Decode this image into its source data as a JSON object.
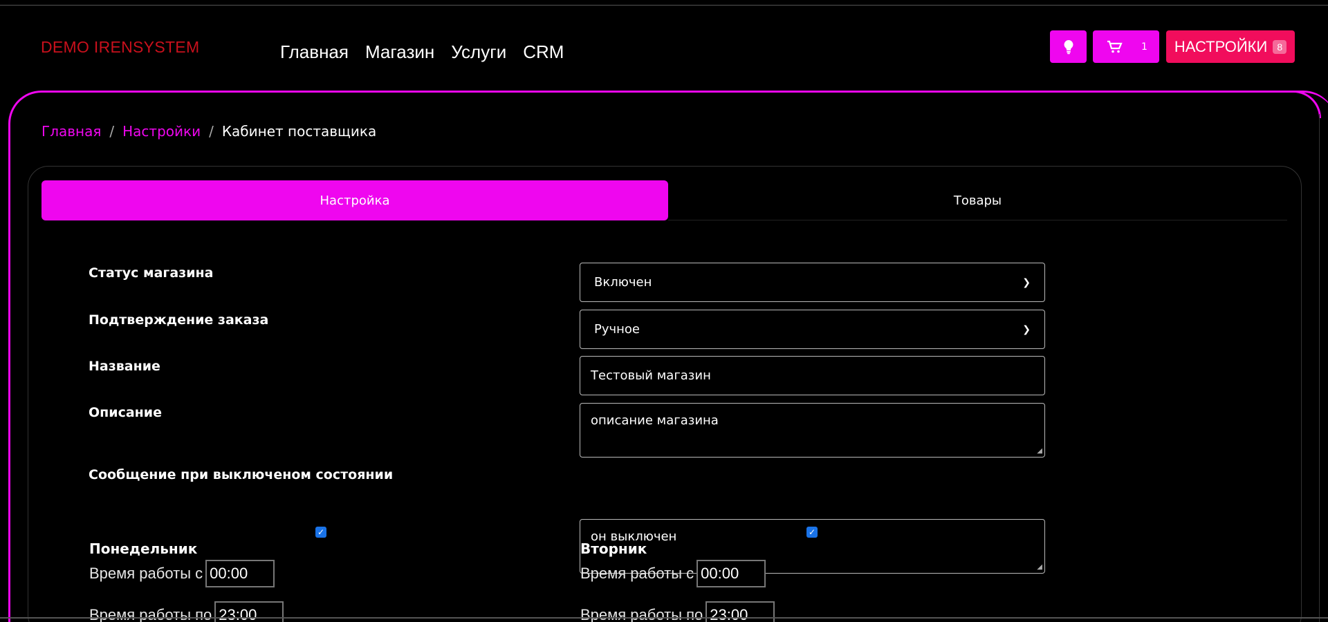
{
  "brand": "DEMO IRENSYSTEM",
  "nav": [
    "Главная",
    "Магазин",
    "Услуги",
    "CRM"
  ],
  "header_buttons": {
    "cart_count": "1",
    "settings_label": "НАСТРОЙКИ",
    "settings_badge": "8"
  },
  "breadcrumb": {
    "home": "Главная",
    "settings": "Настройки",
    "current": "Кабинет поставщика",
    "sep": "/"
  },
  "tabs": {
    "settings": "Настройка",
    "goods": "Товары"
  },
  "form": {
    "status_label": "Статус магазина",
    "status_value": "Включен",
    "confirm_label": "Подтверждение заказа",
    "confirm_value": "Ручное",
    "name_label": "Название",
    "name_value": "Тестовый магазин",
    "desc_label": "Описание",
    "desc_value": "описание магазина",
    "off_msg_label": "Сообщение при выключеном состоянии",
    "off_msg_value": "он выключен"
  },
  "schedule": [
    {
      "day": "Понедельник",
      "checked": true,
      "from_label": "Время работы с",
      "from": "00:00",
      "to_label": "Время работы по",
      "to": "23:00"
    },
    {
      "day": "Вторник",
      "checked": true,
      "from_label": "Время работы с",
      "from": "00:00",
      "to_label": "Время работы по",
      "to": "23:00"
    }
  ],
  "colors": {
    "accent": "#ef06ef",
    "settings_btn": "#f10d5c",
    "brand": "#c8101c",
    "checkbox": "#1a73e8"
  }
}
